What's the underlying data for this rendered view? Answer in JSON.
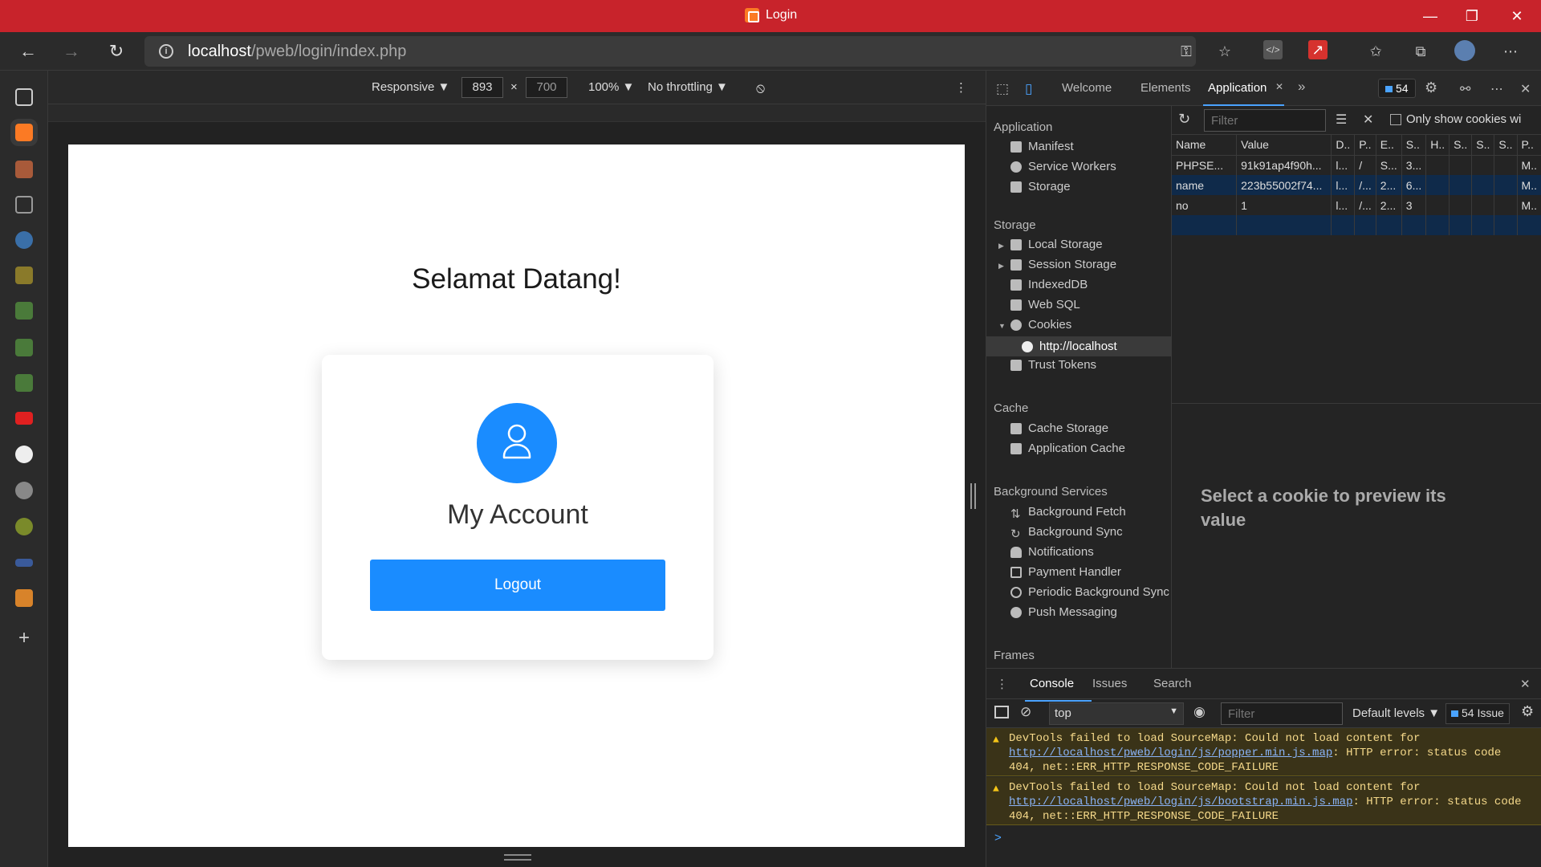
{
  "window": {
    "title": "Login",
    "controls": [
      "minimize",
      "restore",
      "close"
    ]
  },
  "address_bar": {
    "host": "localhost",
    "path": "/pweb/login/index.php"
  },
  "viewport_toolbar": {
    "device": "Responsive ▼",
    "width": "893",
    "times": "×",
    "height": "700",
    "zoom": "100% ▼",
    "throttling": "No throttling ▼",
    "more": "⋮"
  },
  "page": {
    "heading": "Selamat Datang!",
    "account_title": "My Account",
    "logout_label": "Logout"
  },
  "devtools": {
    "tabs": [
      "Welcome",
      "Elements",
      "Application"
    ],
    "more_tabs": "»",
    "issues_count": "54",
    "close": "✕",
    "app_tree": {
      "application_header": "Application",
      "application_items": [
        "Manifest",
        "Service Workers",
        "Storage"
      ],
      "storage_header": "Storage",
      "storage_items": [
        "Local Storage",
        "Session Storage",
        "IndexedDB",
        "Web SQL",
        "Cookies"
      ],
      "cookie_origin": "http://localhost",
      "trust_tokens": "Trust Tokens",
      "cache_header": "Cache",
      "cache_items": [
        "Cache Storage",
        "Application Cache"
      ],
      "bg_header": "Background Services",
      "bg_items": [
        "Background Fetch",
        "Background Sync",
        "Notifications",
        "Payment Handler",
        "Periodic Background Sync",
        "Push Messaging"
      ],
      "frames_header": "Frames"
    },
    "cookies": {
      "filter_placeholder": "Filter",
      "only_show_label": "Only show cookies wi",
      "columns": [
        "Name",
        "Value",
        "D..",
        "P..",
        "E..",
        "S..",
        "H..",
        "S..",
        "S..",
        "S..",
        "P.."
      ],
      "rows": [
        [
          "PHPSE...",
          "91k91ap4f90h...",
          "l...",
          "/",
          "S...",
          "3...",
          "",
          "",
          "",
          "",
          "M.."
        ],
        [
          "name",
          "223b55002f74...",
          "l...",
          "/...",
          "2...",
          "6...",
          "",
          "",
          "",
          "",
          "M.."
        ],
        [
          "no",
          "1",
          "l...",
          "/...",
          "2...",
          "3",
          "",
          "",
          "",
          "",
          "M.."
        ]
      ],
      "preview_text": "Select a cookie to preview its value"
    },
    "drawer": {
      "more": "⋮",
      "tabs": [
        "Console",
        "Issues",
        "Search"
      ],
      "context": "top",
      "filter_placeholder": "Filter",
      "levels": "Default levels ▼",
      "issues": "54 Issue",
      "messages": [
        {
          "prefix": "DevTools failed to load SourceMap: Could not load content for ",
          "link": "http://localhost/pweb/login/js/popper.min.js.map",
          "suffix": ": HTTP error: status code 404, net::ERR_HTTP_RESPONSE_CODE_FAILURE"
        },
        {
          "prefix": "DevTools failed to load SourceMap: Could not load content for ",
          "link": "http://localhost/pweb/login/js/bootstrap.min.js.map",
          "suffix": ": HTTP error: status code 404, net::ERR_HTTP_RESPONSE_CODE_FAILURE"
        }
      ],
      "prompt": ">"
    }
  },
  "colors": {
    "titlebar": "#c8232b",
    "primary_button": "#1a8cff",
    "devtools_bg": "#242424"
  }
}
